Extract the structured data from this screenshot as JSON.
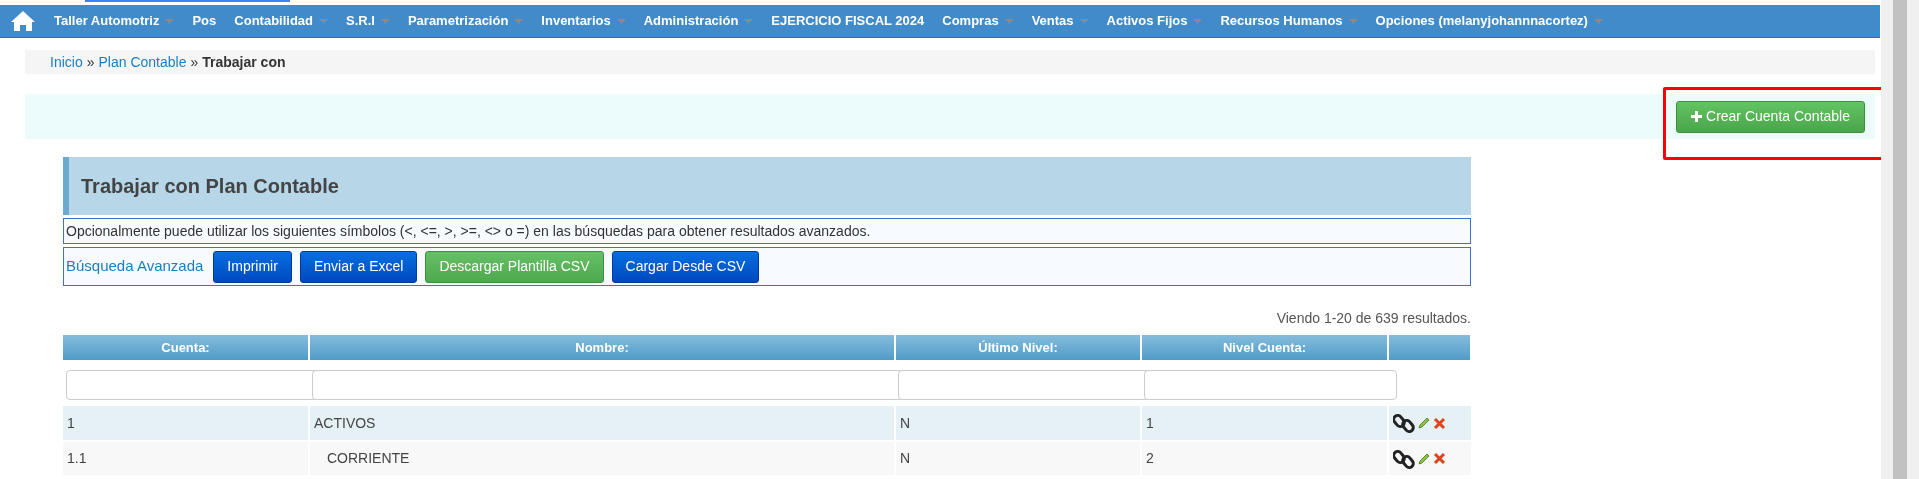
{
  "menu": [
    {
      "label": "Taller Automotriz",
      "dropdown": true
    },
    {
      "label": "Pos",
      "dropdown": false
    },
    {
      "label": "Contabilidad",
      "dropdown": true
    },
    {
      "label": "S.R.I",
      "dropdown": true
    },
    {
      "label": "Parametrización",
      "dropdown": true
    },
    {
      "label": "Inventarios",
      "dropdown": true
    },
    {
      "label": "Administración",
      "dropdown": true
    },
    {
      "label": "EJERCICIO FISCAL 2024",
      "dropdown": false
    },
    {
      "label": "Compras",
      "dropdown": true
    },
    {
      "label": "Ventas",
      "dropdown": true
    },
    {
      "label": "Activos Fijos",
      "dropdown": true
    },
    {
      "label": "Recursos Humanos",
      "dropdown": true
    },
    {
      "label": "Opciones (melanyjohannnacortez)",
      "dropdown": true
    }
  ],
  "breadcrumb": [
    {
      "label": "Inicio",
      "kind": "link"
    },
    {
      "label": "»",
      "kind": "separator"
    },
    {
      "label": "Plan Contable",
      "kind": "link"
    },
    {
      "label": "»",
      "kind": "separator"
    },
    {
      "label": "Trabajar con",
      "kind": "current"
    }
  ],
  "create_button": {
    "label": "Crear Cuenta Contable"
  },
  "panel": {
    "title": "Trabajar con Plan Contable",
    "hint": "Opcionalmente puede utilizar los siguientes símbolos (<, <=, >, >=, <> o =) en las búsquedas para obtener resultados avanzados.",
    "advanced_search": "Búsqueda Avanzada",
    "actions": [
      {
        "label": "Imprimir",
        "kind": "primary"
      },
      {
        "label": "Enviar a Excel",
        "kind": "primary"
      },
      {
        "label": "Descargar Plantilla CSV",
        "kind": "success"
      },
      {
        "label": "Cargar Desde CSV",
        "kind": "primary"
      }
    ]
  },
  "summary": "Viendo 1-20 de 639 resultados.",
  "table": {
    "columns": [
      {
        "label": "Cuenta:",
        "filter": true
      },
      {
        "label": "Nombre:",
        "filter": true
      },
      {
        "label": "Último Nivel:",
        "filter": true
      },
      {
        "label": "Nivel Cuenta:",
        "filter": true
      },
      {
        "filter": false
      }
    ],
    "rows": [
      {
        "cells": [
          "1",
          "ACTIVOS",
          "N",
          "1"
        ],
        "children": [
          {
            "cells": [
              "1.1",
              "CORRIENTE",
              "N",
              "2"
            ]
          }
        ]
      }
    ]
  }
}
